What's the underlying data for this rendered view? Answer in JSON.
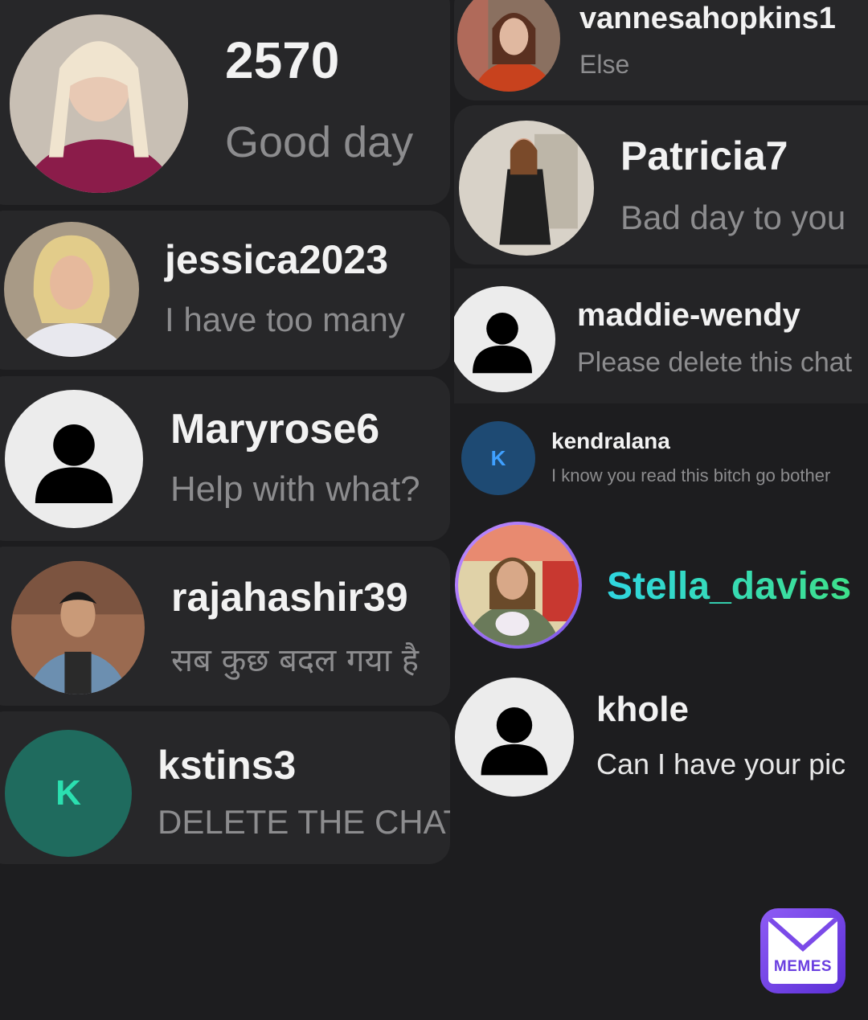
{
  "left_chats": [
    {
      "name": "2570",
      "message": "Good day"
    },
    {
      "name": "jessica2023",
      "message": "I have too many"
    },
    {
      "name": "Maryrose6",
      "message": "Help with what?"
    },
    {
      "name": "rajahashir39",
      "message": "सब कुछ बदल गया है"
    },
    {
      "name": "kstins3",
      "message": "DELETE THE CHAT",
      "avatar_letter": "K"
    }
  ],
  "right_chats": [
    {
      "name": "vannesahopkins1",
      "message": "Else"
    },
    {
      "name": "Patricia7",
      "message": "Bad day to you"
    },
    {
      "name": "maddie-wendy",
      "message": "Please delete this chat"
    },
    {
      "name": "kendralana",
      "message": "I know you read this bitch go bother",
      "avatar_letter": "K"
    },
    {
      "name": "Stella_davies",
      "message": ""
    },
    {
      "name": "khole",
      "message": "Can I have your pic"
    }
  ],
  "watermark": {
    "label": "MEMES"
  },
  "colors": {
    "background": "#1d1d1f",
    "card": "#272729",
    "name_text": "#f2f2f2",
    "message_text": "#8c8c8e",
    "highlight_gradient_start": "#2fd6e0",
    "highlight_gradient_end": "#3ee08a",
    "kstins3_avatar": "#1f6b5e",
    "kendralana_avatar": "#1e4a73"
  },
  "icons": {
    "default_avatar": "person-silhouette-icon",
    "watermark": "envelope-logo-icon"
  }
}
